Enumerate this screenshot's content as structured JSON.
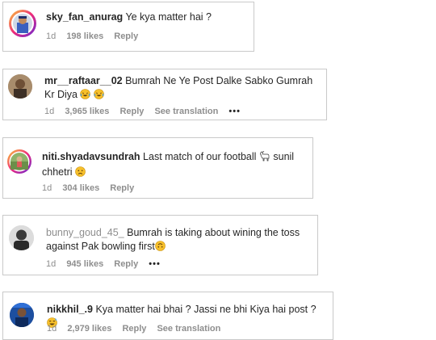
{
  "comments": [
    {
      "username": "sky_fan_anurag",
      "text": "Ye kya matter hai ?",
      "time": "1d",
      "likes": "198 likes",
      "reply": "Reply"
    },
    {
      "username": "mr__raftaar__02",
      "text": "Bumrah Ne Ye Post Dalke Sabko Gumrah Kr Diya",
      "time": "1d",
      "likes": "3,965 likes",
      "reply": "Reply",
      "translation": "See translation",
      "more": "•••"
    },
    {
      "username": "niti.shyadavsundrah",
      "text_a": "Last match of our football",
      "text_b": "sunil chhetri",
      "time": "1d",
      "likes": "304 likes",
      "reply": "Reply"
    },
    {
      "username": "bunny_goud_45_",
      "text": "Bumrah is taking about wining the toss against Pak bowling first",
      "time": "1d",
      "likes": "945 likes",
      "reply": "Reply",
      "more": "•••"
    },
    {
      "username": "nikkhil_.9",
      "text": "Kya matter hai bhai ? Jassi ne bhi Kiya hai post ?",
      "time": "1d",
      "likes": "2,979 likes",
      "reply": "Reply",
      "translation": "See translation"
    }
  ],
  "icons": {
    "laugh_emoji": "face-with-tears-of-joy-icon",
    "football_emoji": "goat-icon",
    "sad_emoji": "disappointed-face-icon",
    "upside_emoji": "upside-down-face-icon",
    "sweat_emoji": "grinning-sweat-face-icon"
  },
  "colors": {
    "text": "#262626",
    "muted": "#8e8e8e",
    "border": "#c9c9c9",
    "emoji": "#f7c02b"
  }
}
